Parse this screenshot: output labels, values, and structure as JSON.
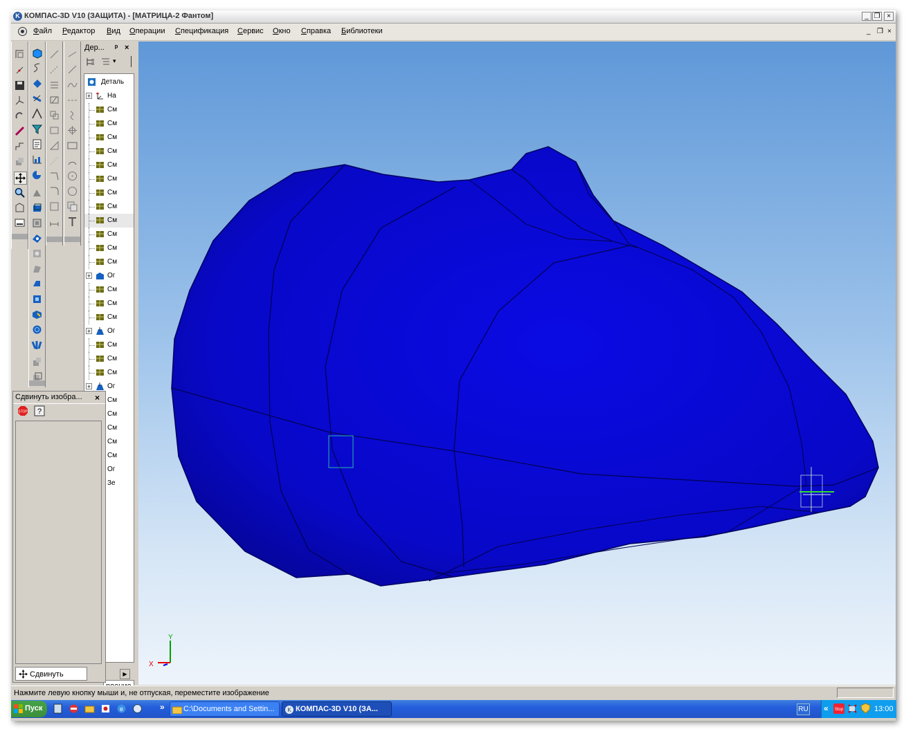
{
  "window": {
    "title": "КОМПАС-3D V10 (ЗАЩИТА) - [МАТРИЦА-2 Фантом]",
    "min": "_",
    "max": "❐",
    "close": "×"
  },
  "menu": {
    "items": [
      "Файл",
      "Редактор",
      "Вид",
      "Операции",
      "Спецификация",
      "Сервис",
      "Окно",
      "Справка",
      "Библиотеки"
    ],
    "mdi_min": "_",
    "mdi_max": "❐",
    "mdi_close": "×"
  },
  "tree": {
    "header": "Дер...",
    "pin": "ᵖ",
    "close": "×",
    "root": "Деталь",
    "rows": [
      {
        "label": "На",
        "icon": "axes-icon",
        "expand": "+"
      },
      {
        "label": "См",
        "icon": "mesh-icon",
        "expand": ""
      },
      {
        "label": "См",
        "icon": "mesh-icon",
        "expand": ""
      },
      {
        "label": "См",
        "icon": "mesh-icon",
        "expand": ""
      },
      {
        "label": "См",
        "icon": "mesh-icon",
        "expand": ""
      },
      {
        "label": "См",
        "icon": "mesh-icon",
        "expand": ""
      },
      {
        "label": "См",
        "icon": "mesh-icon",
        "expand": ""
      },
      {
        "label": "См",
        "icon": "mesh-icon",
        "expand": ""
      },
      {
        "label": "См",
        "icon": "mesh-icon",
        "expand": ""
      },
      {
        "label": "См",
        "icon": "mesh-icon",
        "expand": ""
      },
      {
        "label": "См",
        "icon": "mesh-icon",
        "expand": ""
      },
      {
        "label": "См",
        "icon": "mesh-icon",
        "expand": ""
      },
      {
        "label": "См",
        "icon": "mesh-icon",
        "expand": ""
      },
      {
        "label": "Ог",
        "icon": "solid-icon",
        "expand": "+"
      },
      {
        "label": "См",
        "icon": "mesh-icon",
        "expand": ""
      },
      {
        "label": "См",
        "icon": "mesh-icon",
        "expand": ""
      },
      {
        "label": "См",
        "icon": "mesh-icon",
        "expand": ""
      },
      {
        "label": "Ог",
        "icon": "loft-icon",
        "expand": "+"
      },
      {
        "label": "См",
        "icon": "mesh-icon",
        "expand": ""
      },
      {
        "label": "См",
        "icon": "mesh-icon",
        "expand": ""
      },
      {
        "label": "См",
        "icon": "mesh-icon",
        "expand": ""
      },
      {
        "label": "Ог",
        "icon": "loft-icon",
        "expand": "+"
      },
      {
        "label": "См",
        "icon": "mesh-icon",
        "expand": ""
      },
      {
        "label": "См",
        "icon": "mesh-icon",
        "expand": ""
      },
      {
        "label": "См",
        "icon": "mesh-icon",
        "expand": ""
      },
      {
        "label": "См",
        "icon": "mesh-icon",
        "expand": ""
      },
      {
        "label": "См",
        "icon": "plane-icon",
        "expand": ""
      },
      {
        "label": "Ог",
        "icon": "loft-icon",
        "expand": ""
      },
      {
        "label": "Зе",
        "icon": "mirror-icon",
        "expand": ""
      }
    ],
    "tab": "роение"
  },
  "panel": {
    "title": "Сдвинуть изобра...",
    "close": "×",
    "tab": "Сдвинуть"
  },
  "viewport": {
    "axis_x": "X",
    "axis_y": "Y",
    "model_color": "#0a0ad8"
  },
  "status": {
    "text": "Нажмите левую кнопку мыши и, не отпуская, переместите изображение"
  },
  "taskbar": {
    "start": "Пуск",
    "more": "»",
    "items": [
      "C:\\Documents and Settin...",
      "КОМПАС-3D V10 (ЗА..."
    ],
    "lang": "RU",
    "tray_more": "«",
    "clock": "13:00"
  }
}
